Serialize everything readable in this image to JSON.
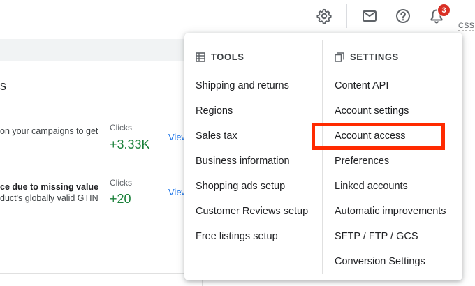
{
  "topbar": {
    "notification_count": "3",
    "css_tag": "CSS",
    "icons": [
      "gear-icon",
      "mail-icon",
      "help-icon",
      "bell-icon"
    ]
  },
  "background": {
    "card_title_partial": "s",
    "rows": [
      {
        "text": "on your campaigns to get",
        "bold": false,
        "clicks_label": "Clicks",
        "clicks_value": "+3.33K",
        "link": "View"
      },
      {
        "text": "ce due to missing value",
        "subtext": "duct's globally valid GTIN",
        "bold": true,
        "clicks_label": "Clicks",
        "clicks_value": "+20",
        "link": "View"
      }
    ]
  },
  "menu": {
    "tools": {
      "heading": "TOOLS",
      "items": [
        "Shipping and returns",
        "Regions",
        "Sales tax",
        "Business information",
        "Shopping ads setup",
        "Customer Reviews setup",
        "Free listings setup"
      ]
    },
    "settings": {
      "heading": "SETTINGS",
      "items": [
        "Content API",
        "Account settings",
        "Account access",
        "Preferences",
        "Linked accounts",
        "Automatic improvements",
        "SFTP / FTP / GCS",
        "Conversion Settings"
      ]
    },
    "highlighted_item": "Account access",
    "highlight_color": "#ff2a00"
  }
}
